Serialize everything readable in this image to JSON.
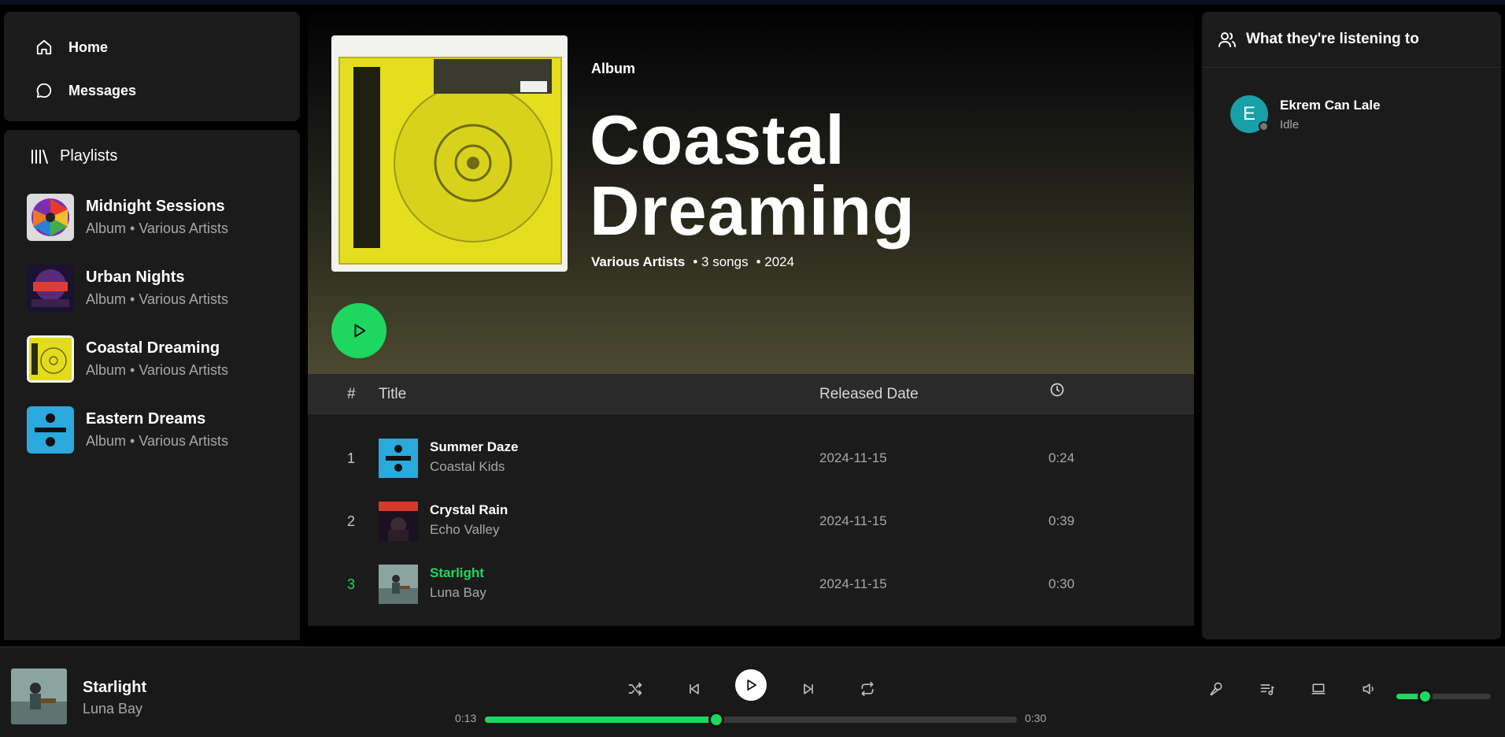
{
  "nav": {
    "home_label": "Home",
    "messages_label": "Messages"
  },
  "library": {
    "heading": "Playlists",
    "items": [
      {
        "title": "Midnight Sessions",
        "subtitle": "Album • Various Artists"
      },
      {
        "title": "Urban Nights",
        "subtitle": "Album • Various Artists"
      },
      {
        "title": "Coastal Dreaming",
        "subtitle": "Album • Various Artists"
      },
      {
        "title": "Eastern Dreams",
        "subtitle": "Album • Various Artists"
      }
    ]
  },
  "album": {
    "type": "Album",
    "title": "Coastal Dreaming",
    "artist": "Various Artists",
    "songs": "• 3 songs",
    "year": "• 2024"
  },
  "table": {
    "col_num": "#",
    "col_title": "Title",
    "col_date": "Released Date",
    "duration_icon": "clock-icon",
    "rows": [
      {
        "num": "1",
        "title": "Summer Daze",
        "artist": "Coastal Kids",
        "date": "2024-11-15",
        "duration": "0:24"
      },
      {
        "num": "2",
        "title": "Crystal Rain",
        "artist": "Echo Valley",
        "date": "2024-11-15",
        "duration": "0:39"
      },
      {
        "num": "3",
        "title": "Starlight",
        "artist": "Luna Bay",
        "date": "2024-11-15",
        "duration": "0:30"
      }
    ],
    "active_row": 3
  },
  "friends": {
    "heading": "What they're listening to",
    "items": [
      {
        "initial": "E",
        "name": "Ekrem Can Lale",
        "status": "Idle"
      }
    ]
  },
  "player": {
    "title": "Starlight",
    "artist": "Luna Bay",
    "elapsed": "0:13",
    "total": "0:30",
    "progress": 0.435,
    "volume": 0.3
  },
  "colors": {
    "accent": "#1ed760",
    "panel": "#1b1b1b",
    "avatar": "#17a0a8"
  }
}
